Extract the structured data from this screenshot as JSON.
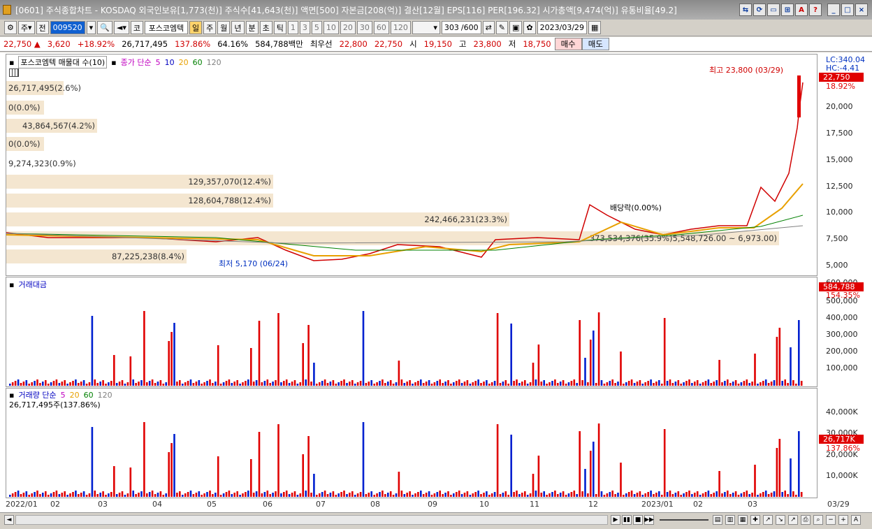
{
  "window": {
    "title": "[0601] 주식종합차트 - KOSDAQ 외국인보유[1,773(천)] 주식수[41,643(천)] 액면[500] 자본금[208(억)] 결산[12월] EPS[116] PER[196.32] 시가총액[9,474(억)] 유통비율[49.2]"
  },
  "toolbar": {
    "period_select": "주",
    "prev_btn": "전",
    "code": "009520",
    "name": "포스코엠텍",
    "market": "코",
    "periods": [
      "일",
      "주",
      "월",
      "년",
      "분",
      "초",
      "틱"
    ],
    "active_period": "일",
    "minute_options": [
      "1",
      "3",
      "5",
      "10",
      "20",
      "30",
      "60",
      "120"
    ],
    "count": "303",
    "count_max": "/600",
    "date": "2023/03/29"
  },
  "quote": {
    "price": "22,750",
    "arrow": "▲",
    "change": "3,620",
    "change_pct": "+18.92%",
    "volume": "26,717,495",
    "volume_ratio": "137.86%",
    "turnover": "64.16%",
    "trade_value": "584,788백만",
    "best_bid_label": "최우선",
    "best_ask": "22,800",
    "best_bid": "22,750",
    "open_label": "시",
    "open": "19,150",
    "high_label": "고",
    "high": "23,800",
    "low_label": "저",
    "low": "18,750",
    "buy": "매수",
    "sell": "매도"
  },
  "price_pane": {
    "title": "포스코엠텍 매물대 수(10)",
    "ma_label": "종가 단순",
    "ma_periods": [
      "5",
      "10",
      "20",
      "60",
      "120"
    ],
    "ma_colors": [
      "#c000c0",
      "#0000c0",
      "#e8a000",
      "#008000",
      "#808080"
    ],
    "lc": "LC:340.04",
    "hc": "HC:-4.41",
    "price_tag": "22,750",
    "pct_tag": "18.92%",
    "y_labels": [
      "20,000",
      "17,500",
      "15,000",
      "12,500",
      "10,000",
      "7,500",
      "5,000"
    ],
    "volume_profile": [
      "26,717,495(2.6%)",
      "0(0.0%)",
      "43,864,567(4.2%)",
      "0(0.0%)",
      "9,274,323(0.9%)",
      "129,357,070(12.4%)",
      "128,604,788(12.4%)",
      "242,466,231(23.3%)",
      "373,534,376(35.9%)",
      "87,225,238(8.4%)"
    ],
    "range_label": "5,548,726.00 ~ 6,973.00)",
    "high_note": "최고 23,800 (03/29)",
    "low_note": "최저 5,170 (06/24)",
    "dividend_note": "배당락(0.00%)"
  },
  "value_pane": {
    "title": "거래대금",
    "tag": "584,788",
    "pct_tag": "154.35%",
    "y_labels": [
      "500,000",
      "400,000",
      "300,000",
      "200,000",
      "100,000"
    ],
    "top_label": "600,000"
  },
  "volume_pane": {
    "title": "거래량 단순",
    "ma_periods": [
      "5",
      "20",
      "60",
      "120"
    ],
    "ma_colors": [
      "#c000c0",
      "#e8a000",
      "#008000",
      "#808080"
    ],
    "current": "26,717,495주(137.86%)",
    "tag": "26,717K",
    "pct_tag": "137.86%",
    "y_labels": [
      "40,000K",
      "30,000K",
      "20,000K",
      "10,000K"
    ]
  },
  "x_axis": [
    "2022/01",
    "02",
    "03",
    "04",
    "05",
    "06",
    "07",
    "08",
    "09",
    "10",
    "11",
    "12",
    "2023/01",
    "02",
    "03",
    "03/29"
  ]
}
